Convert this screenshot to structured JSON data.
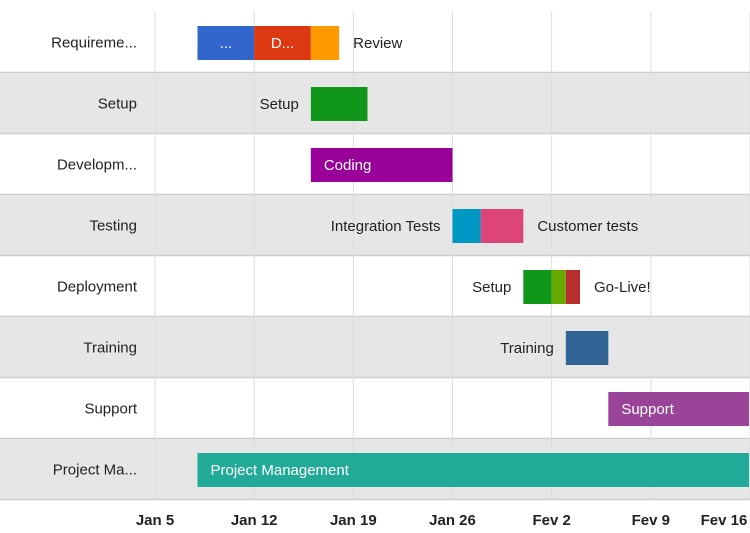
{
  "chart_data": {
    "type": "gantt",
    "x_axis": {
      "ticks": [
        {
          "label": "Jan 5",
          "day": 0
        },
        {
          "label": "Jan 12",
          "day": 7
        },
        {
          "label": "Jan 19",
          "day": 14
        },
        {
          "label": "Jan 26",
          "day": 21
        },
        {
          "label": "Fev 2",
          "day": 28
        },
        {
          "label": "Fev 9",
          "day": 35
        },
        {
          "label": "Fev 16",
          "day": 42
        }
      ],
      "range": [
        "Jan 5",
        "Fev 16"
      ]
    },
    "grid": true,
    "rows": [
      {
        "label": "Requireme...",
        "tasks": [
          {
            "label": "...",
            "start": "Jan 8",
            "end": "Jan 12",
            "color": "#3366cc",
            "label_position": "inside"
          },
          {
            "label": "D...",
            "start": "Jan 12",
            "end": "Jan 16",
            "color": "#dc3912",
            "label_position": "inside"
          },
          {
            "label": "Review",
            "start": "Jan 16",
            "end": "Jan 18",
            "color": "#ff9900",
            "label_position": "right"
          }
        ]
      },
      {
        "label": "Setup",
        "tasks": [
          {
            "label": "Setup",
            "start": "Jan 16",
            "end": "Jan 20",
            "color": "#109618",
            "label_position": "left"
          }
        ]
      },
      {
        "label": "Developm...",
        "tasks": [
          {
            "label": "Coding",
            "start": "Jan 16",
            "end": "Jan 26",
            "color": "#990099",
            "label_position": "inside"
          }
        ]
      },
      {
        "label": "Testing",
        "tasks": [
          {
            "label": "Integration Tests",
            "start": "Jan 26",
            "end": "Jan 28",
            "color": "#0099c6",
            "label_position": "left"
          },
          {
            "label": "Customer tests",
            "start": "Jan 28",
            "end": "Jan 31",
            "color": "#dd4477",
            "label_position": "right"
          }
        ]
      },
      {
        "label": "Deployment",
        "tasks": [
          {
            "label": "Setup",
            "start": "Jan 31",
            "end": "Fev 2",
            "color": "#109618",
            "label_position": "left"
          },
          {
            "label": "",
            "start": "Fev 2",
            "end": "Fev 3",
            "color": "#66aa00",
            "label_position": "none"
          },
          {
            "label": "Go-Live!",
            "start": "Fev 3",
            "end": "Fev 4",
            "color": "#b82e2e",
            "label_position": "right"
          }
        ]
      },
      {
        "label": "Training",
        "tasks": [
          {
            "label": "Training",
            "start": "Fev 3",
            "end": "Fev 6",
            "color": "#316395",
            "label_position": "left"
          }
        ]
      },
      {
        "label": "Support",
        "tasks": [
          {
            "label": "Support",
            "start": "Fev 6",
            "end": "Fev 16",
            "color": "#994499",
            "label_position": "inside"
          }
        ]
      },
      {
        "label": "Project Ma...",
        "tasks": [
          {
            "label": "Project Management",
            "start": "Jan 8",
            "end": "Fev 16",
            "color": "#22aa99",
            "label_position": "inside"
          }
        ]
      }
    ],
    "colors": {
      "row_band": "#e6e6e6",
      "row_separator": "#cccccc",
      "gridline": "#dddddd",
      "background": "#ffffff"
    }
  }
}
